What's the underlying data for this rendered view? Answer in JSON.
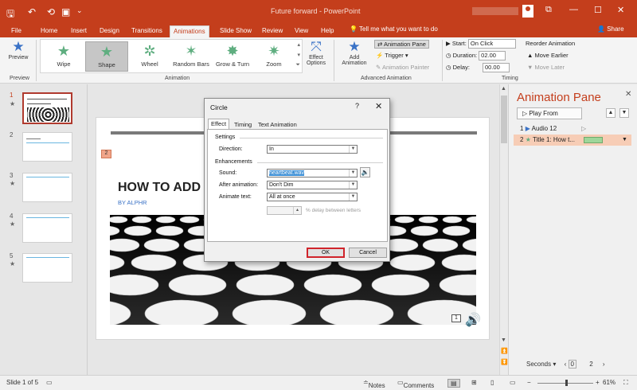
{
  "titlebar": {
    "title": "Future forward - PowerPoint",
    "qa_save": "🖫",
    "qa_undo": "↶",
    "qa_redo": "⟲",
    "qa_present": "▣",
    "qa_more": "⌄",
    "win_restore": "⧉",
    "win_min": "—",
    "win_max": "☐",
    "win_close": "✕"
  },
  "tabs": [
    "File",
    "Home",
    "Insert",
    "Design",
    "Transitions",
    "Animations",
    "Slide Show",
    "Review",
    "View",
    "Help"
  ],
  "active_tab": "Animations",
  "tellme": "Tell me what you want to do",
  "share": "Share",
  "ribbon": {
    "preview": "Preview",
    "preview_group": "Preview",
    "animations": [
      {
        "label": "Wipe",
        "icon": "★"
      },
      {
        "label": "Shape",
        "icon": "★"
      },
      {
        "label": "Wheel",
        "icon": "✲"
      },
      {
        "label": "Random Bars",
        "icon": "✶"
      },
      {
        "label": "Grow & Turn",
        "icon": "✸"
      },
      {
        "label": "Zoom",
        "icon": "✷"
      }
    ],
    "selected_animation": "Shape",
    "effect_options": "Effect Options",
    "animation_group": "Animation",
    "add_animation": "Add Animation",
    "animation_pane": "Animation Pane",
    "trigger": "Trigger",
    "animation_painter": "Animation Painter",
    "advanced_group": "Advanced Animation",
    "start_label": "Start:",
    "start_value": "On Click",
    "duration_label": "Duration:",
    "duration_value": "02.00",
    "delay_label": "Delay:",
    "delay_value": "00.00",
    "reorder": "Reorder Animation",
    "move_earlier": "Move Earlier",
    "move_later": "Move Later",
    "timing_group": "Timing"
  },
  "thumbnails": [
    {
      "num": "1",
      "star": "★"
    },
    {
      "num": "2",
      "star": ""
    },
    {
      "num": "3",
      "star": "★"
    },
    {
      "num": "4",
      "star": "★"
    },
    {
      "num": "5",
      "star": "★"
    }
  ],
  "slide": {
    "tag_top": "2",
    "title": "HOW TO ADD",
    "byline": "BY ALPHR",
    "audio_tag": "1"
  },
  "dialog": {
    "title": "Circle",
    "help": "?",
    "close": "✕",
    "tabs": [
      "Effect",
      "Timing",
      "Text Animation"
    ],
    "settings": "Settings",
    "direction_label": "Direction:",
    "direction_value": "In",
    "enhancements": "Enhancements",
    "sound_label": "Sound:",
    "sound_value": "heartbeat.wav",
    "after_label": "After animation:",
    "after_value": "Don't Dim",
    "animate_text_label": "Animate text:",
    "animate_text_value": "All at once",
    "delay_between": "% delay between letters",
    "ok": "OK",
    "cancel": "Cancel"
  },
  "anim_pane": {
    "title": "Animation Pane",
    "play_from": "Play From",
    "items": [
      {
        "num": "1",
        "label": "Audio 12"
      },
      {
        "num": "2",
        "label": "Title 1: How t..."
      }
    ],
    "seconds": "Seconds",
    "scale_start": "0",
    "scale_end": "2"
  },
  "status": {
    "slide": "Slide 1 of 5",
    "notes": "Notes",
    "comments": "Comments",
    "zoom": "61%"
  },
  "colors": {
    "brand": "#c43e1c",
    "selected_row": "#f7cdb6",
    "ok_outline": "#d0242b"
  }
}
